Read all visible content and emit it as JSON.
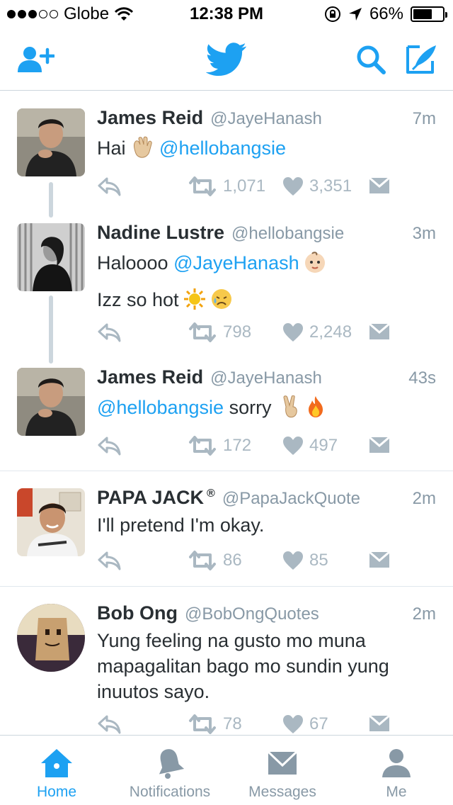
{
  "status_bar": {
    "carrier": "Globe",
    "time": "12:38 PM",
    "battery": "66%",
    "battery_level": 0.66
  },
  "nav": {
    "icons": [
      "add-user-icon",
      "twitter-bird-icon",
      "search-icon",
      "compose-icon"
    ]
  },
  "tweets": [
    {
      "name": "James Reid",
      "handle": "@JayeHanash",
      "time": "7m",
      "text": [
        "Hai",
        "@hellobangsie"
      ],
      "retweets": "1,071",
      "likes": "3,351"
    },
    {
      "name": "Nadine Lustre",
      "handle": "@hellobangsie",
      "time": "3m",
      "text": [
        "Haloooo",
        "@JayeHanash",
        "Izz so hot"
      ],
      "retweets": "798",
      "likes": "2,248"
    },
    {
      "name": "James Reid",
      "handle": "@JayeHanash",
      "time": "43s",
      "text": [
        "@hellobangsie",
        "sorry"
      ],
      "retweets": "172",
      "likes": "497"
    },
    {
      "name": "PAPA JACK",
      "badge": "®",
      "handle": "@PapaJackQuote",
      "time": "2m",
      "text": [
        "I'll pretend I'm okay."
      ],
      "retweets": "86",
      "likes": "85"
    },
    {
      "name": "Bob Ong",
      "handle": "@BobOngQuotes",
      "time": "2m",
      "text": [
        "Yung feeling na gusto mo muna",
        "mapagalitan bago mo sundin yung",
        "inuutos sayo."
      ],
      "retweets": "78",
      "likes": "67"
    }
  ],
  "tabs": [
    {
      "label": "Home",
      "icon": "home-icon",
      "active": true
    },
    {
      "label": "Notifications",
      "icon": "bell-icon",
      "active": false
    },
    {
      "label": "Messages",
      "icon": "envelope-icon",
      "active": false
    },
    {
      "label": "Me",
      "icon": "person-icon",
      "active": false
    }
  ],
  "colors": {
    "accent": "#1da1f2",
    "muted": "#8899a6",
    "action": "#aab8c2"
  }
}
